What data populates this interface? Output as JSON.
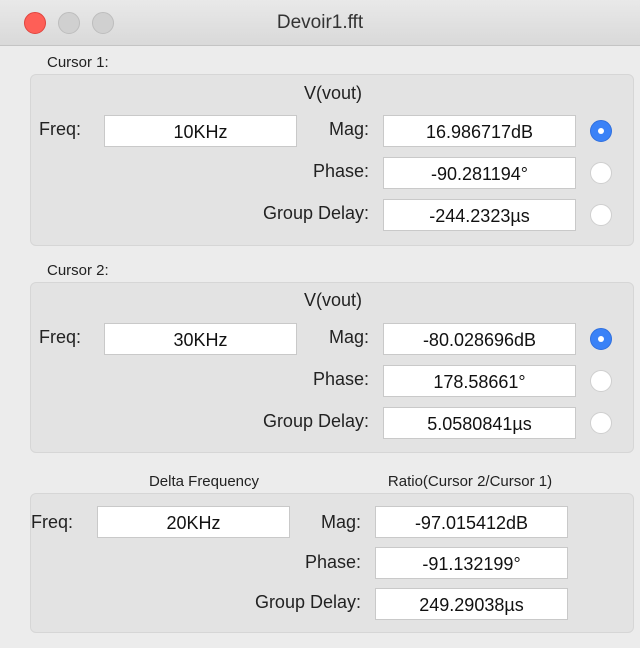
{
  "window": {
    "title": "Devoir1.fft"
  },
  "cursor1": {
    "section_label": "Cursor 1:",
    "signal": "V(vout)",
    "freq_label": "Freq:",
    "freq_value": "10KHz",
    "mag_label": "Mag:",
    "mag_value": "16.986717dB",
    "phase_label": "Phase:",
    "phase_value": "-90.281194°",
    "group_delay_label": "Group Delay:",
    "group_delay_value": "-244.2323µs",
    "selected": "mag"
  },
  "cursor2": {
    "section_label": "Cursor 2:",
    "signal": "V(vout)",
    "freq_label": "Freq:",
    "freq_value": "30KHz",
    "mag_label": "Mag:",
    "mag_value": "-80.028696dB",
    "phase_label": "Phase:",
    "phase_value": "178.58661°",
    "group_delay_label": "Group Delay:",
    "group_delay_value": "5.0580841µs",
    "selected": "mag"
  },
  "delta": {
    "delta_header": "Delta Frequency",
    "ratio_header": "Ratio(Cursor 2/Cursor 1)",
    "freq_label": "Freq:",
    "freq_value": "20KHz",
    "mag_label": "Mag:",
    "mag_value": "-97.015412dB",
    "phase_label": "Phase:",
    "phase_value": "-91.132199°",
    "group_delay_label": "Group Delay:",
    "group_delay_value": "249.29038µs"
  },
  "colors": {
    "close": "#fe5f57",
    "radio_selected": "#3a82f7",
    "panel": "#e3e3e3"
  }
}
